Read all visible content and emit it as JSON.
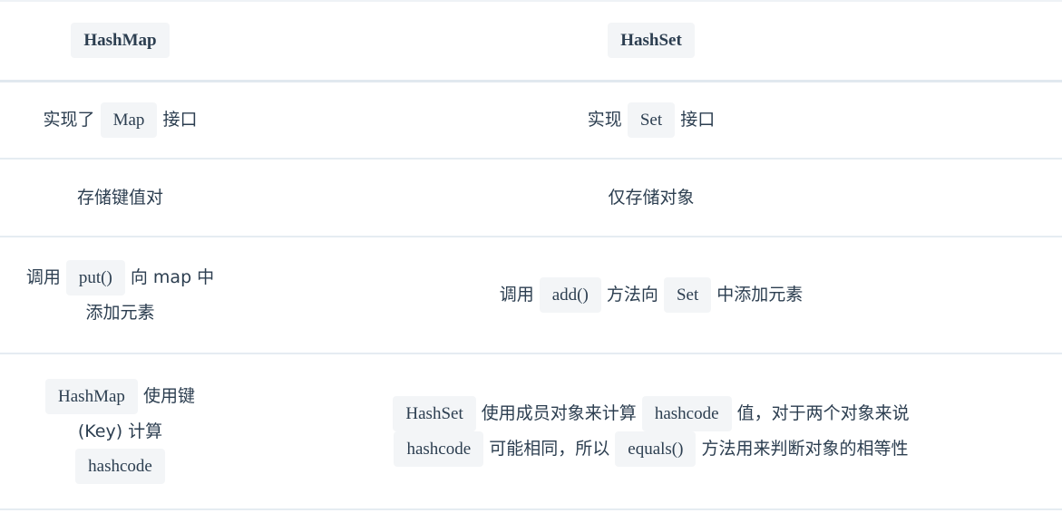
{
  "table": {
    "headers": [
      "HashMap",
      "HashSet"
    ],
    "rows": [
      {
        "left": {
          "pre": "实现了",
          "code": "Map",
          "post": "接口"
        },
        "right": {
          "pre": "实现",
          "code": "Set",
          "post": "接口"
        }
      },
      {
        "left": {
          "text": "存储键值对"
        },
        "right": {
          "text": "仅存储对象"
        }
      },
      {
        "left": {
          "pre": "调用",
          "code": "put()",
          "post": "向 map 中",
          "line2": "添加元素"
        },
        "right": {
          "pre": "调用",
          "code": "add()",
          "mid": "方法向",
          "code2": "Set",
          "post": "中添加元素"
        }
      },
      {
        "left": {
          "code": "HashMap",
          "post": "使用键",
          "line2": "(Key) 计算",
          "code2": "hashcode"
        },
        "right": {
          "code": "HashSet",
          "mid": "使用成员对象来计算",
          "code2": "hashcode",
          "post": "值，对于两个对象来说",
          "code3": "hashcode",
          "mid2": "可能相同，所以",
          "code4": "equals()",
          "post2": "方法用来判断对象的相等性"
        }
      }
    ]
  }
}
